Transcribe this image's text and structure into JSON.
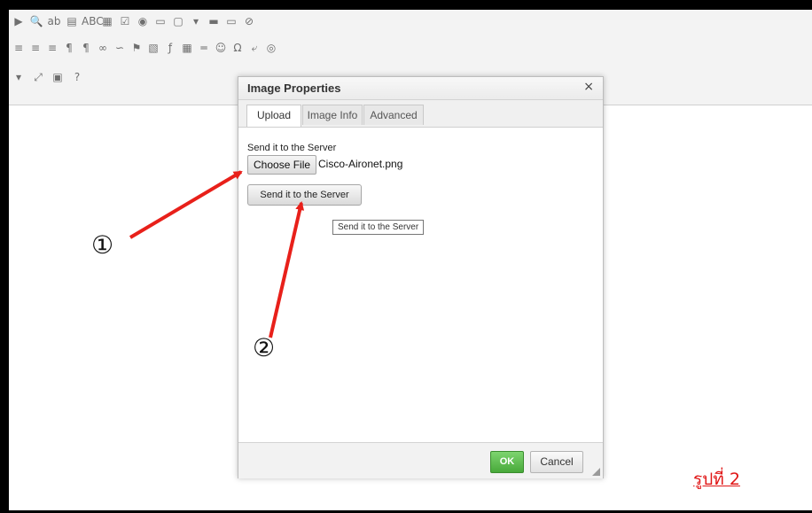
{
  "toolbar": {
    "row1_icons": [
      "play-icon",
      "find-icon",
      "replace-icon",
      "select-all-icon",
      "spellcheck-icon",
      "form-icon",
      "checkbox-icon",
      "radio-icon",
      "textfield-icon",
      "textarea-icon",
      "select-icon",
      "button-icon",
      "imagebutton-icon",
      "hiddenfield-icon"
    ],
    "row2_icons": [
      "align-center-icon",
      "align-right-icon",
      "justify-icon",
      "ltr-icon",
      "rtl-icon",
      "link-icon",
      "unlink-icon",
      "anchor-icon",
      "image-icon",
      "flash-icon",
      "table-icon",
      "hr-icon",
      "smiley-icon",
      "specialchar-icon",
      "pagebreak-icon",
      "iframe-icon"
    ],
    "row3_icons": [
      "dropdown-icon",
      "maximize-icon",
      "showblocks-icon",
      "help-icon"
    ],
    "glyphs": {
      "play-icon": "▶",
      "find-icon": "🔍",
      "replace-icon": "ab",
      "select-all-icon": "▤",
      "spellcheck-icon": "ABC",
      "form-icon": "▦",
      "checkbox-icon": "☑",
      "radio-icon": "◉",
      "textfield-icon": "▭",
      "textarea-icon": "▢",
      "select-icon": "▾",
      "button-icon": "▬",
      "imagebutton-icon": "▭",
      "hiddenfield-icon": "⊘",
      "align-center-icon": "≡",
      "align-right-icon": "≡",
      "justify-icon": "≡",
      "ltr-icon": "¶",
      "rtl-icon": "¶",
      "link-icon": "∞",
      "unlink-icon": "∽",
      "anchor-icon": "⚑",
      "image-icon": "▧",
      "flash-icon": "ƒ",
      "table-icon": "▦",
      "hr-icon": "═",
      "smiley-icon": "☺",
      "specialchar-icon": "Ω",
      "pagebreak-icon": "⤶",
      "iframe-icon": "◎",
      "dropdown-icon": "▾",
      "maximize-icon": "⤢",
      "showblocks-icon": "▣",
      "help-icon": "?"
    }
  },
  "dialog": {
    "title": "Image Properties",
    "close_glyph": "×",
    "tabs": [
      "Upload",
      "Image Info",
      "Advanced"
    ],
    "active_tab": "Upload",
    "send_label": "Send it to the Server",
    "choose_button": "Choose File",
    "file_name": "Cisco-Aironet.png",
    "send_button": "Send it to the Server",
    "tooltip": "Send it to the Server",
    "ok": "OK",
    "cancel": "Cancel"
  },
  "annotations": {
    "marker1": "①",
    "marker2": "②",
    "arrow_color": "#e8201a"
  },
  "caption": "รูปที่ 2",
  "colors": {
    "border": "#000000",
    "ok_green": "#48a93a",
    "caption_red": "#e01515"
  }
}
